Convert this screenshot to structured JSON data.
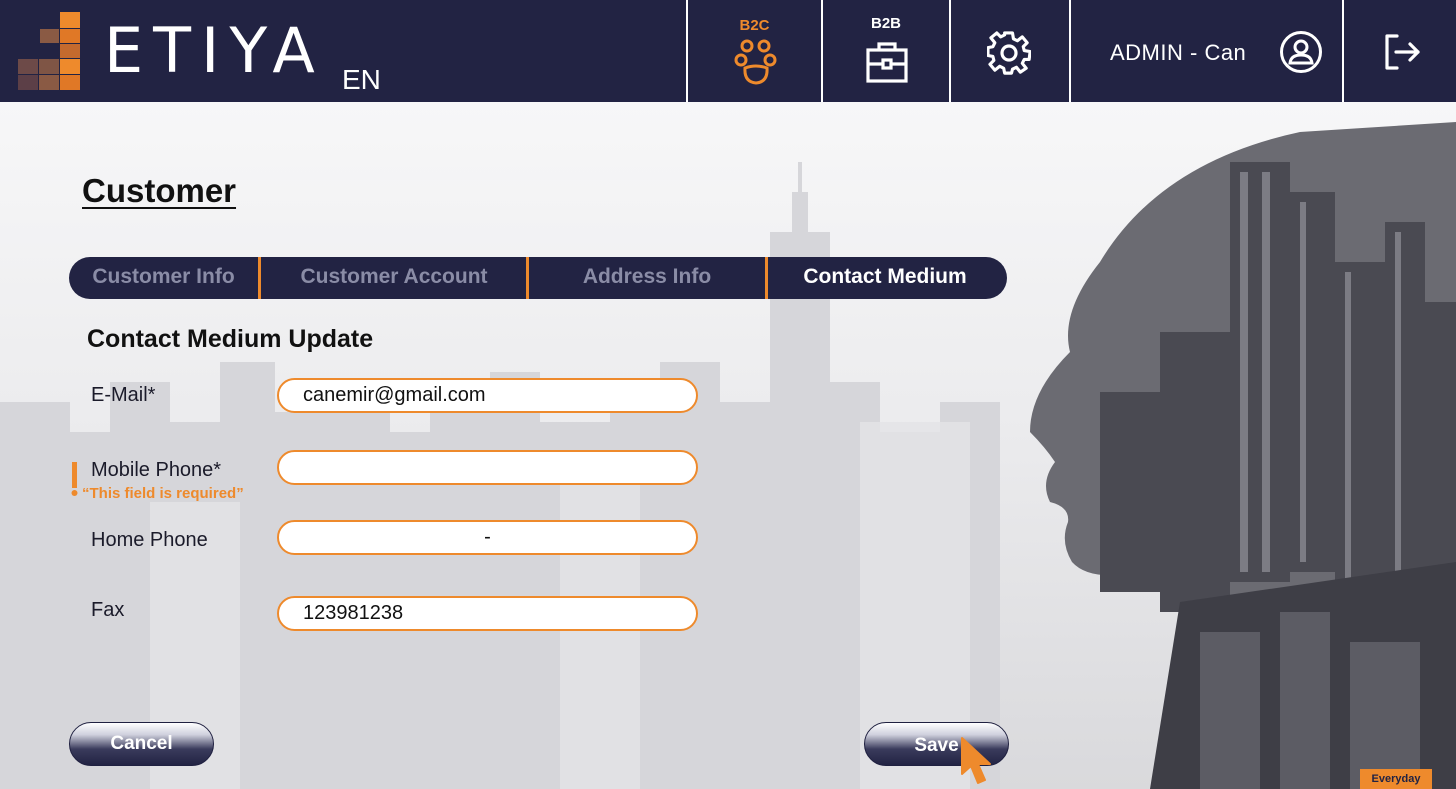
{
  "header": {
    "logo_text": "ETIYA",
    "language": "EN",
    "b2c_label": "B2C",
    "b2b_label": "B2B",
    "user_name": "ADMIN - Can",
    "accent_color": "#EE8A2C",
    "bar_color": "#222343"
  },
  "page": {
    "title": "Customer",
    "section_title": "Contact Medium Update"
  },
  "tabs": [
    {
      "label": "Customer Info",
      "active": false
    },
    {
      "label": "Customer Account",
      "active": false
    },
    {
      "label": "Address Info",
      "active": false
    },
    {
      "label": "Contact Medium",
      "active": true
    }
  ],
  "form": {
    "email": {
      "label": "E-Mail*",
      "value": "canemir@gmail.com"
    },
    "mobile_phone": {
      "label": "Mobile Phone*",
      "value": "",
      "error": "“This field is required”"
    },
    "home_phone": {
      "label": "Home Phone",
      "value": "-"
    },
    "fax": {
      "label": "Fax",
      "value": "123981238"
    }
  },
  "actions": {
    "cancel_label": "Cancel",
    "save_label": "Save"
  },
  "footer_badge": "Everyday",
  "icons": [
    "b2c-people-icon",
    "b2b-briefcase-icon",
    "gear-icon",
    "user-avatar-icon",
    "logout-icon",
    "error-exclamation-icon",
    "mouse-cursor-icon"
  ]
}
